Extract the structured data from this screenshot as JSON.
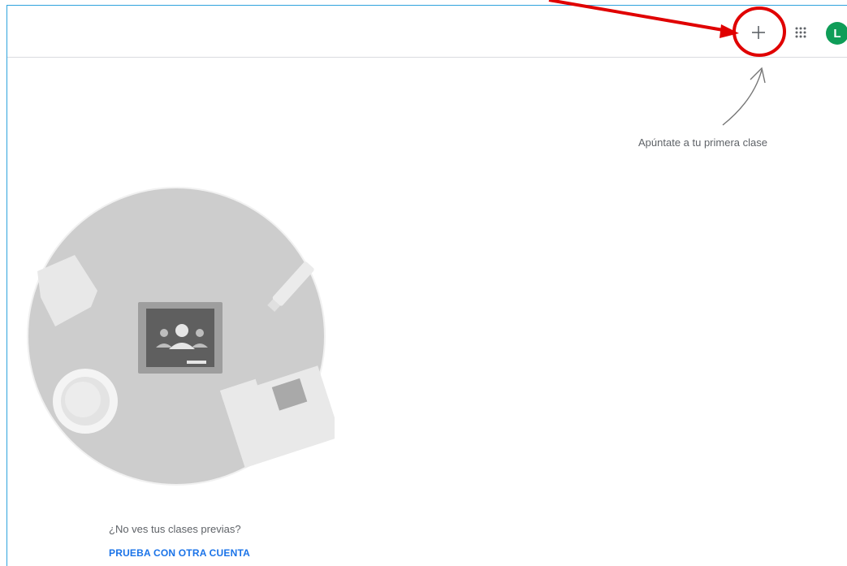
{
  "header": {
    "add_icon": "plus-icon",
    "apps_icon": "apps-grid-icon",
    "avatar_initial": "L",
    "avatar_color": "#0f9d58"
  },
  "main": {
    "hint_text": "Apúntate a tu primera clase",
    "previous_classes_text": "¿No ves tus clases previas?",
    "try_other_account_link": "PRUEBA CON OTRA CUENTA"
  },
  "annotation": {
    "highlight_color": "#e00000"
  },
  "colors": {
    "accent": "#1a73e8",
    "frame_border": "#2ea3dd"
  }
}
